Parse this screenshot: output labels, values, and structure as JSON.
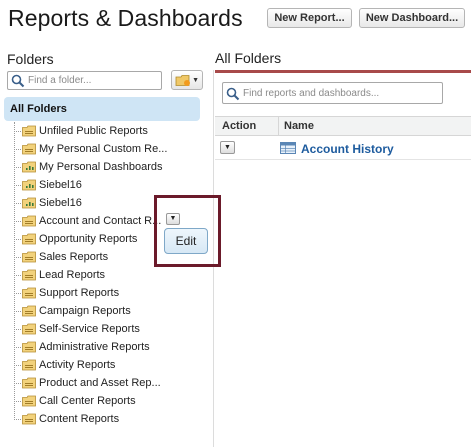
{
  "header": {
    "title": "Reports & Dashboards",
    "new_report_label": "New Report...",
    "new_dashboard_label": "New Dashboard..."
  },
  "sidebar": {
    "heading": "Folders",
    "search_placeholder": "Find a folder...",
    "all_folders_label": "All Folders",
    "items": [
      {
        "label": "Unfiled Public Reports",
        "icon": "report-folder-icon"
      },
      {
        "label": "My Personal Custom Re...",
        "icon": "report-folder-icon"
      },
      {
        "label": "My Personal Dashboards",
        "icon": "dashboard-folder-icon"
      },
      {
        "label": "Siebel16",
        "icon": "dashboard-folder-icon"
      },
      {
        "label": "Siebel16",
        "icon": "dashboard-folder-icon"
      },
      {
        "label": "Account and Contact R...",
        "icon": "report-folder-icon"
      },
      {
        "label": "Opportunity Reports",
        "icon": "report-folder-icon"
      },
      {
        "label": "Sales Reports",
        "icon": "report-folder-icon"
      },
      {
        "label": "Lead Reports",
        "icon": "report-folder-icon"
      },
      {
        "label": "Support Reports",
        "icon": "report-folder-icon"
      },
      {
        "label": "Campaign Reports",
        "icon": "report-folder-icon"
      },
      {
        "label": "Self-Service Reports",
        "icon": "report-folder-icon"
      },
      {
        "label": "Administrative Reports",
        "icon": "report-folder-icon"
      },
      {
        "label": "Activity Reports",
        "icon": "report-folder-icon"
      },
      {
        "label": "Product and Asset Rep...",
        "icon": "report-folder-icon"
      },
      {
        "label": "Call Center Reports",
        "icon": "report-folder-icon"
      },
      {
        "label": "Content Reports",
        "icon": "report-folder-icon"
      }
    ],
    "context_menu": {
      "edit_label": "Edit"
    }
  },
  "main": {
    "heading": "All Folders",
    "search_placeholder": "Find reports and dashboards...",
    "columns": [
      "Action",
      "Name"
    ],
    "rows": [
      {
        "name": "Account History"
      }
    ]
  },
  "colors": {
    "accent": "#a84a4a",
    "selected_row": "#cfe5f5",
    "link": "#1d5b9e",
    "callout": "#6b1a2a"
  }
}
